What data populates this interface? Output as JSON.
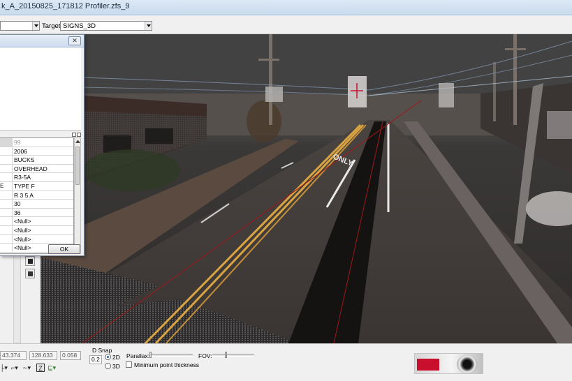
{
  "window": {
    "title": "k_A_20150825_171812 Profiler.zfs_9"
  },
  "toolbar": {
    "source_value": "",
    "target_label": "Target:",
    "target_value": "SIGNS_3D"
  },
  "dialog": {
    "close_label": "✕",
    "ok_label": "OK",
    "rows": [
      {
        "key": "",
        "value": "99"
      },
      {
        "key": "",
        "value": "2006"
      },
      {
        "key": "",
        "value": "BUCKS"
      },
      {
        "key": "",
        "value": "OVERHEAD"
      },
      {
        "key": "",
        "value": "R3-5A"
      },
      {
        "key": "E",
        "value": "TYPE F"
      },
      {
        "key": "",
        "value": "R 3 5 A"
      },
      {
        "key": "",
        "value": "30"
      },
      {
        "key": "",
        "value": "36"
      },
      {
        "key": "",
        "value": "<Null>"
      },
      {
        "key": "",
        "value": "<Null>"
      },
      {
        "key": "",
        "value": "<Null>"
      },
      {
        "key": "",
        "value": "<Null>"
      }
    ]
  },
  "viewport": {
    "road_marking_text": "ONLY"
  },
  "bottom": {
    "coord_x": "43.374",
    "coord_y": "128.633",
    "coord_z": "0.058",
    "dsnap_label": "D Snap",
    "dsnap_value": "0.2",
    "mode_2d": "2D",
    "mode_3d": "3D",
    "mode_selected": "2D",
    "parallax_label": "Parallax:",
    "fov_label": "FOV:",
    "min_point_label": "Minimum point thickness",
    "min_point_checked": false
  },
  "icons": [
    "close-icon",
    "save-icon",
    "dropdown-icon",
    "curve-tool-icon",
    "snap-z-icon",
    "flag-icon"
  ],
  "colors": {
    "titlebar": "#c9dbee",
    "accent_red": "#c8102e",
    "road_yellow": "#d9a441"
  }
}
